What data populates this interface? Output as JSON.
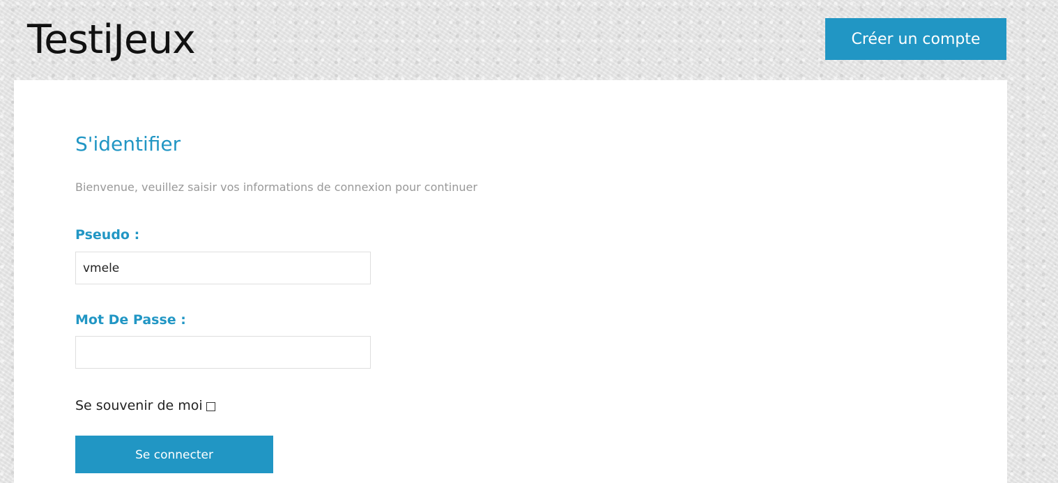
{
  "header": {
    "site_title": "TestiJeux",
    "signup_label": "Créer un compte"
  },
  "login": {
    "title": "S'identifier",
    "subtitle": "Bienvenue, veuillez saisir vos informations de connexion pour continuer",
    "username_label": "Pseudo :",
    "username_value": "vmele",
    "password_label": "Mot De Passe :",
    "password_value": "",
    "remember_label": "Se souvenir de moi",
    "remember_checked": false,
    "submit_label": "Se connecter"
  },
  "colors": {
    "accent": "#2196c4",
    "page_background": "#e6e6e6",
    "panel_background": "#ffffff",
    "subtitle_text": "#999999"
  },
  "icons": {
    "remember_checkbox": "empty-square-checkbox"
  }
}
